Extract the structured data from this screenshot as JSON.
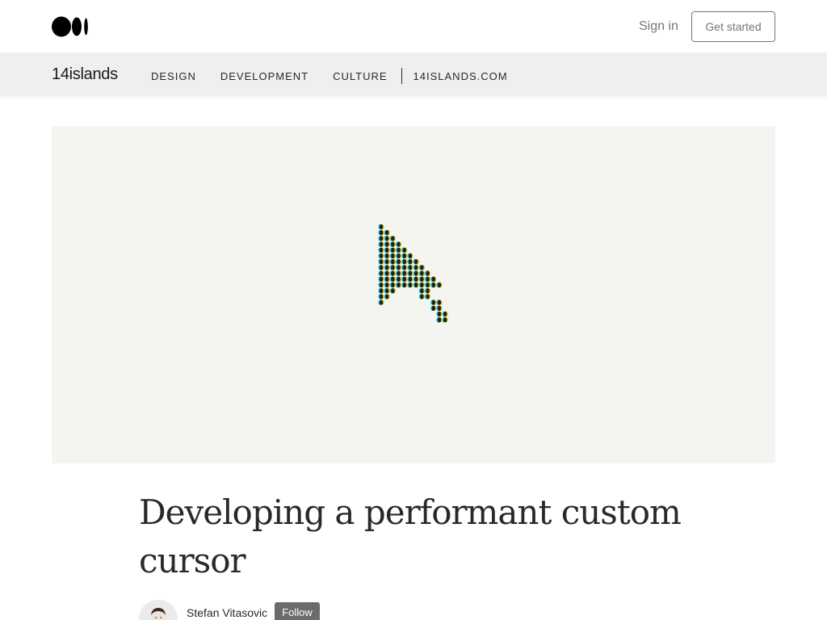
{
  "topbar": {
    "logo_icon": "medium-logo-icon",
    "sign_in_label": "Sign in",
    "get_started_label": "Get started"
  },
  "publication": {
    "name": "14islands",
    "nav": [
      {
        "label": "DESIGN"
      },
      {
        "label": "DEVELOPMENT"
      },
      {
        "label": "CULTURE"
      },
      {
        "label": "14ISLANDS.COM"
      }
    ]
  },
  "hero": {
    "image_icon": "pixel-cursor-arrow-icon",
    "background_color": "#f4f4f1"
  },
  "article": {
    "title": "Developing a performant custom cursor"
  },
  "author": {
    "name": "Stefan Vitasovic",
    "follow_label": "Follow"
  },
  "colors": {
    "pubbar_bg": "#f0efed",
    "text": "#292929",
    "muted": "#757575"
  }
}
